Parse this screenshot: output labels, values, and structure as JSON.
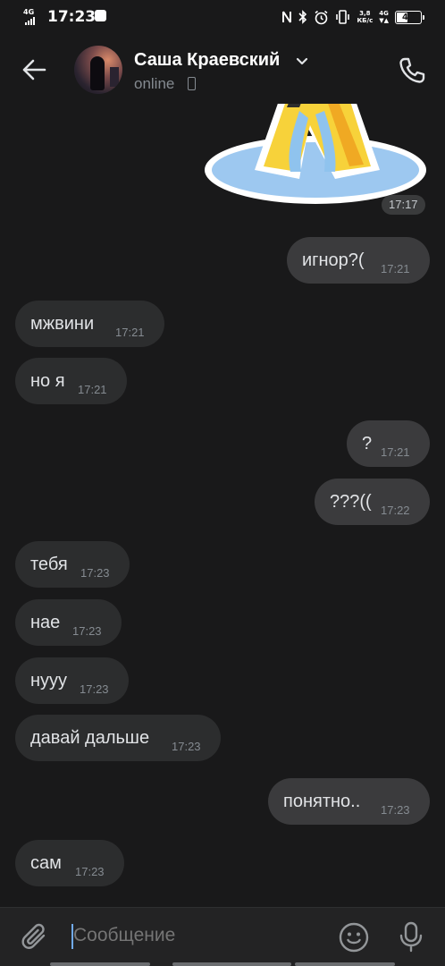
{
  "status_bar": {
    "network": "4G",
    "time": "17:23",
    "speed": "3,8\nКБ/с",
    "lte": "4G",
    "battery": "43"
  },
  "header": {
    "name": "Саша Краевский",
    "status": "online"
  },
  "sticker": {
    "time": "17:17"
  },
  "messages": [
    {
      "text": "игнор?(",
      "time": "17:21",
      "direction": "out"
    },
    {
      "text": "мжвини",
      "time": "17:21",
      "direction": "in"
    },
    {
      "text": "но я",
      "time": "17:21",
      "direction": "in"
    },
    {
      "text": "?",
      "time": "17:21",
      "direction": "out"
    },
    {
      "text": "???((",
      "time": "17:22",
      "direction": "out"
    },
    {
      "text": "тебя",
      "time": "17:23",
      "direction": "in"
    },
    {
      "text": "нае",
      "time": "17:23",
      "direction": "in"
    },
    {
      "text": "нууу",
      "time": "17:23",
      "direction": "in"
    },
    {
      "text": "давай дальше",
      "time": "17:23",
      "direction": "in"
    },
    {
      "text": "понятно..",
      "time": "17:23",
      "direction": "out"
    },
    {
      "text": "сам",
      "time": "17:23",
      "direction": "in"
    }
  ],
  "composer": {
    "placeholder": "Сообщение",
    "value": ""
  },
  "colors": {
    "background": "#19191a",
    "bubble": "#2c2d2e",
    "accent": "#71aaeb",
    "muted": "#858b91"
  },
  "icons": [
    "back-arrow-icon",
    "chevron-down-icon",
    "mobile-icon",
    "phone-icon",
    "paperclip-icon",
    "smile-icon",
    "microphone-icon"
  ]
}
